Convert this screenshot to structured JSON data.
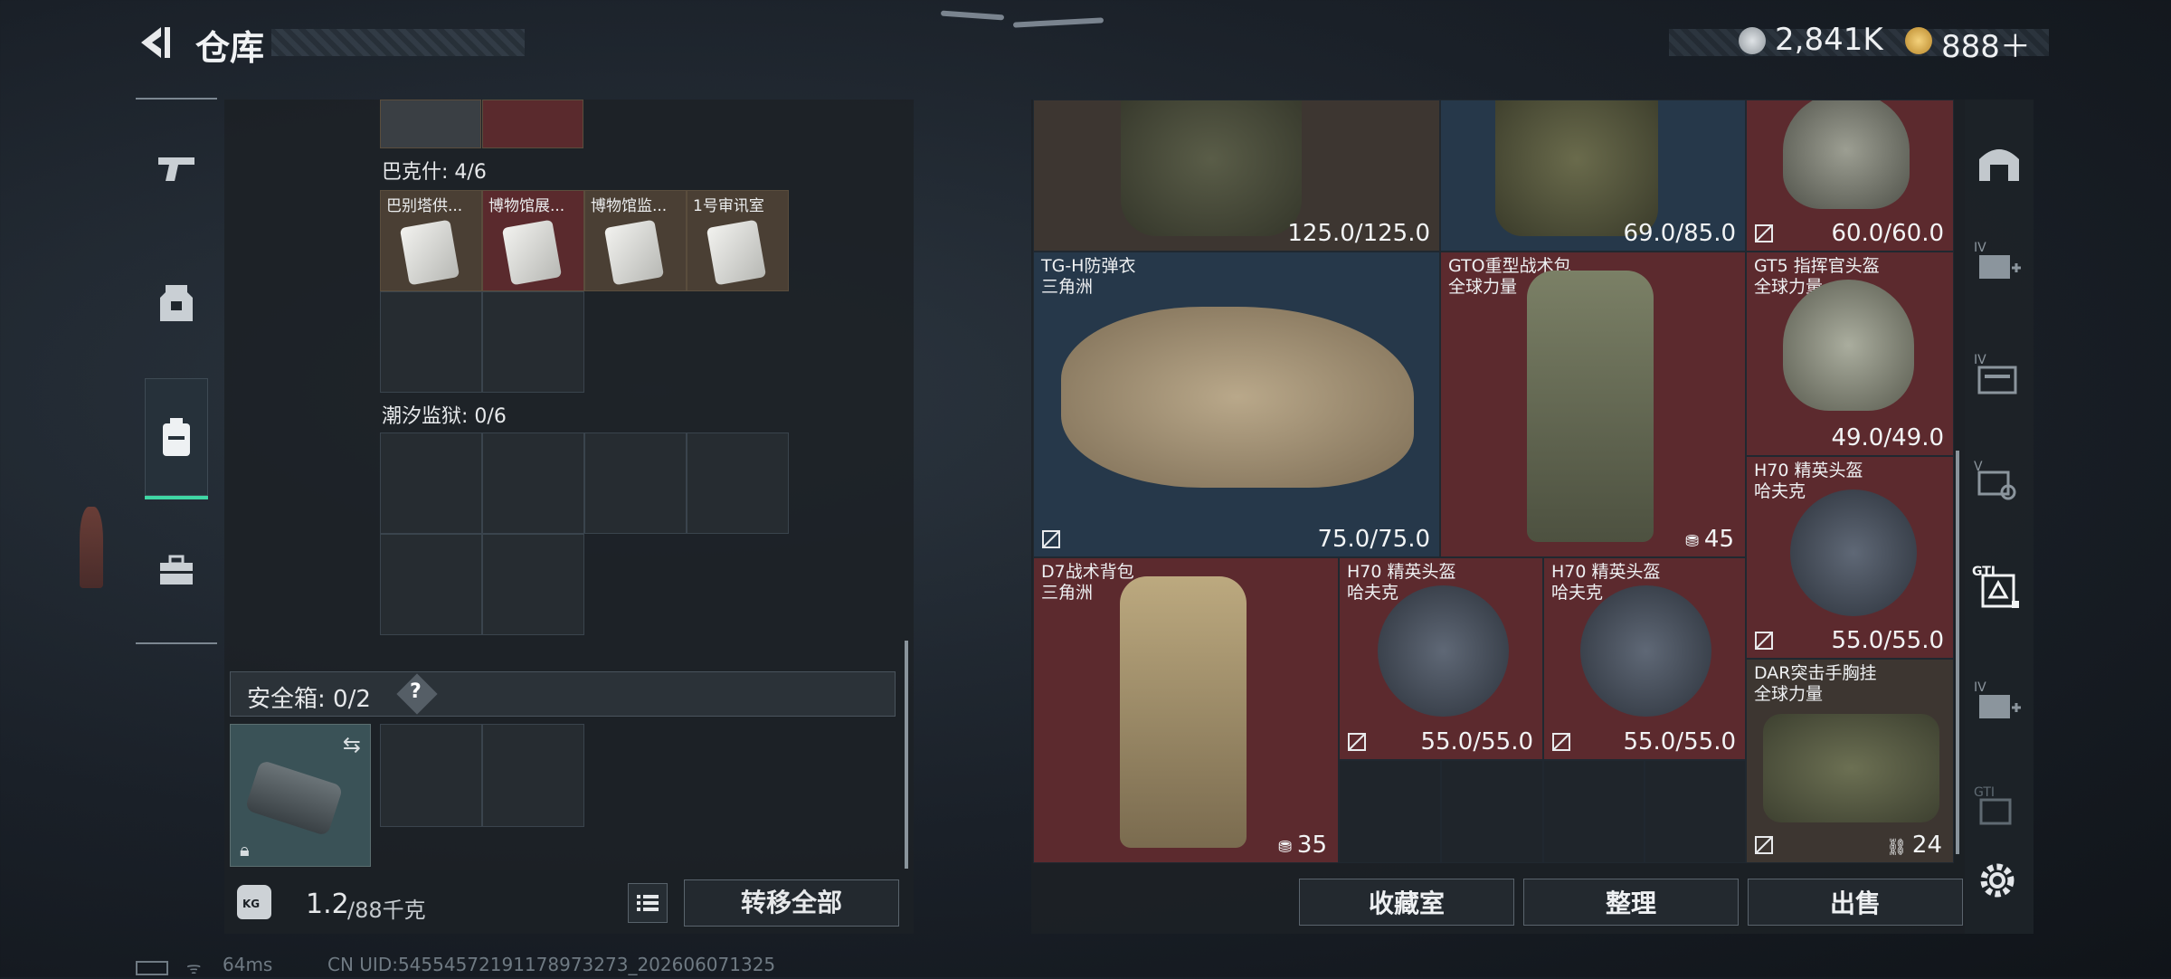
{
  "header": {
    "title": "仓库",
    "currency_1": "2,841K",
    "currency_2": "888＋"
  },
  "left_nav": [
    "pistol-icon",
    "backpack-icon",
    "vest-icon",
    "toolbox-icon"
  ],
  "left_panel": {
    "section_1": {
      "label": "巴克什: 4/6",
      "items": [
        "巴别塔供...",
        "博物馆展...",
        "博物馆监...",
        "1号审讯室"
      ]
    },
    "section_2": {
      "label": "潮汐监狱: 0/6"
    },
    "safe_box": {
      "label": "安全箱: 0/2",
      "help": "?"
    },
    "weight": {
      "current": "1.2",
      "max": "/88千克",
      "kg": "KG"
    },
    "transfer_all": "转移全部"
  },
  "right_panel": {
    "items": [
      {
        "name": "",
        "brand": "",
        "durability": "125.0/125.0"
      },
      {
        "name": "",
        "brand": "",
        "durability": "69.0/85.0"
      },
      {
        "name": "",
        "brand": "",
        "durability": "60.0/60.0"
      },
      {
        "name": "TG-H防弹衣",
        "brand": "三角洲",
        "durability": "75.0/75.0"
      },
      {
        "name": "GTO重型战术包",
        "brand": "全球力量",
        "count": "45"
      },
      {
        "name": "GT5 指挥官头盔",
        "brand": "全球力量",
        "durability": "49.0/49.0"
      },
      {
        "name": "H70 精英头盔",
        "brand": "哈夫克",
        "durability": "55.0/55.0"
      },
      {
        "name": "D7战术背包",
        "brand": "三角洲",
        "count": "35"
      },
      {
        "name": "H70 精英头盔",
        "brand": "哈夫克",
        "durability": "55.0/55.0"
      },
      {
        "name": "H70 精英头盔",
        "brand": "哈夫克",
        "durability": "55.0/55.0"
      },
      {
        "name": "DAR突击手胸挂",
        "brand": "全球力量",
        "count": "24"
      }
    ],
    "buttons": {
      "collection": "收藏室",
      "organize": "整理",
      "sell": "出售"
    }
  },
  "right_sidebar": {
    "labels": [
      "IV",
      "IV",
      "V",
      "GTI",
      "IV",
      "GTI"
    ]
  },
  "status_bar": {
    "ping": "64ms",
    "uid": "CN UID:54554572191178973273_202606071325"
  }
}
